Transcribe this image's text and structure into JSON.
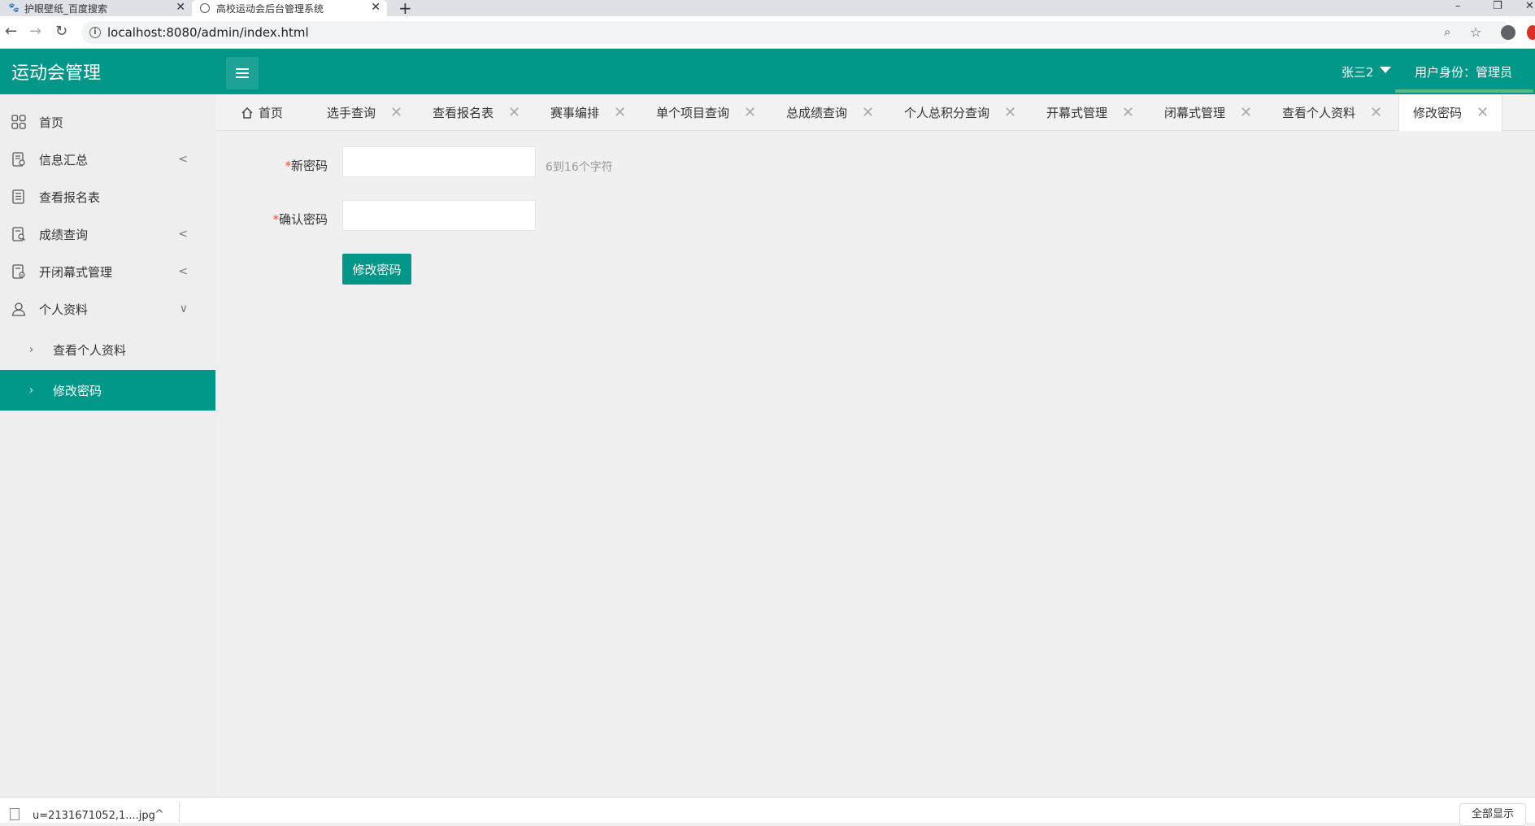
{
  "browser": {
    "tabs": [
      {
        "title": "护眼壁纸_百度搜索"
      },
      {
        "title": "高校运动会后台管理系统"
      }
    ],
    "url": "localhost:8080/admin/index.html"
  },
  "header": {
    "logo": "运动会管理",
    "user_name": "张三2",
    "user_role": "用户身份：管理员"
  },
  "sidebar": {
    "items": [
      {
        "label": "首页",
        "icon": "dashboard-icon"
      },
      {
        "label": "信息汇总",
        "icon": "document-icon",
        "chevron": "<"
      },
      {
        "label": "查看报名表",
        "icon": "list-icon"
      },
      {
        "label": "成绩查询",
        "icon": "search-doc-icon",
        "chevron": "<"
      },
      {
        "label": "开闭幕式管理",
        "icon": "settings-doc-icon",
        "chevron": "<"
      },
      {
        "label": "个人资料",
        "icon": "user-icon",
        "chevron": "∨"
      }
    ],
    "sub_items": [
      {
        "label": "查看个人资料"
      },
      {
        "label": "修改密码",
        "active": true
      }
    ]
  },
  "page_tabs": [
    {
      "label": "首页"
    },
    {
      "label": "选手查询"
    },
    {
      "label": "查看报名表"
    },
    {
      "label": "赛事编排"
    },
    {
      "label": "单个项目查询"
    },
    {
      "label": "总成绩查询"
    },
    {
      "label": "个人总积分查询"
    },
    {
      "label": "开幕式管理"
    },
    {
      "label": "闭幕式管理"
    },
    {
      "label": "查看个人资料"
    },
    {
      "label": "修改密码",
      "active": true
    }
  ],
  "form": {
    "new_password_label": "新密码",
    "confirm_password_label": "确认密码",
    "required_mark": "*",
    "new_password_value": "",
    "confirm_password_value": "",
    "hint": "6到16个字符",
    "submit_label": "修改密码"
  },
  "download_bar": {
    "file_name": "u=2131671052,1....jpg",
    "show_all": "全部显示"
  },
  "colors": {
    "primary": "#009688",
    "required": "#ff5722"
  }
}
